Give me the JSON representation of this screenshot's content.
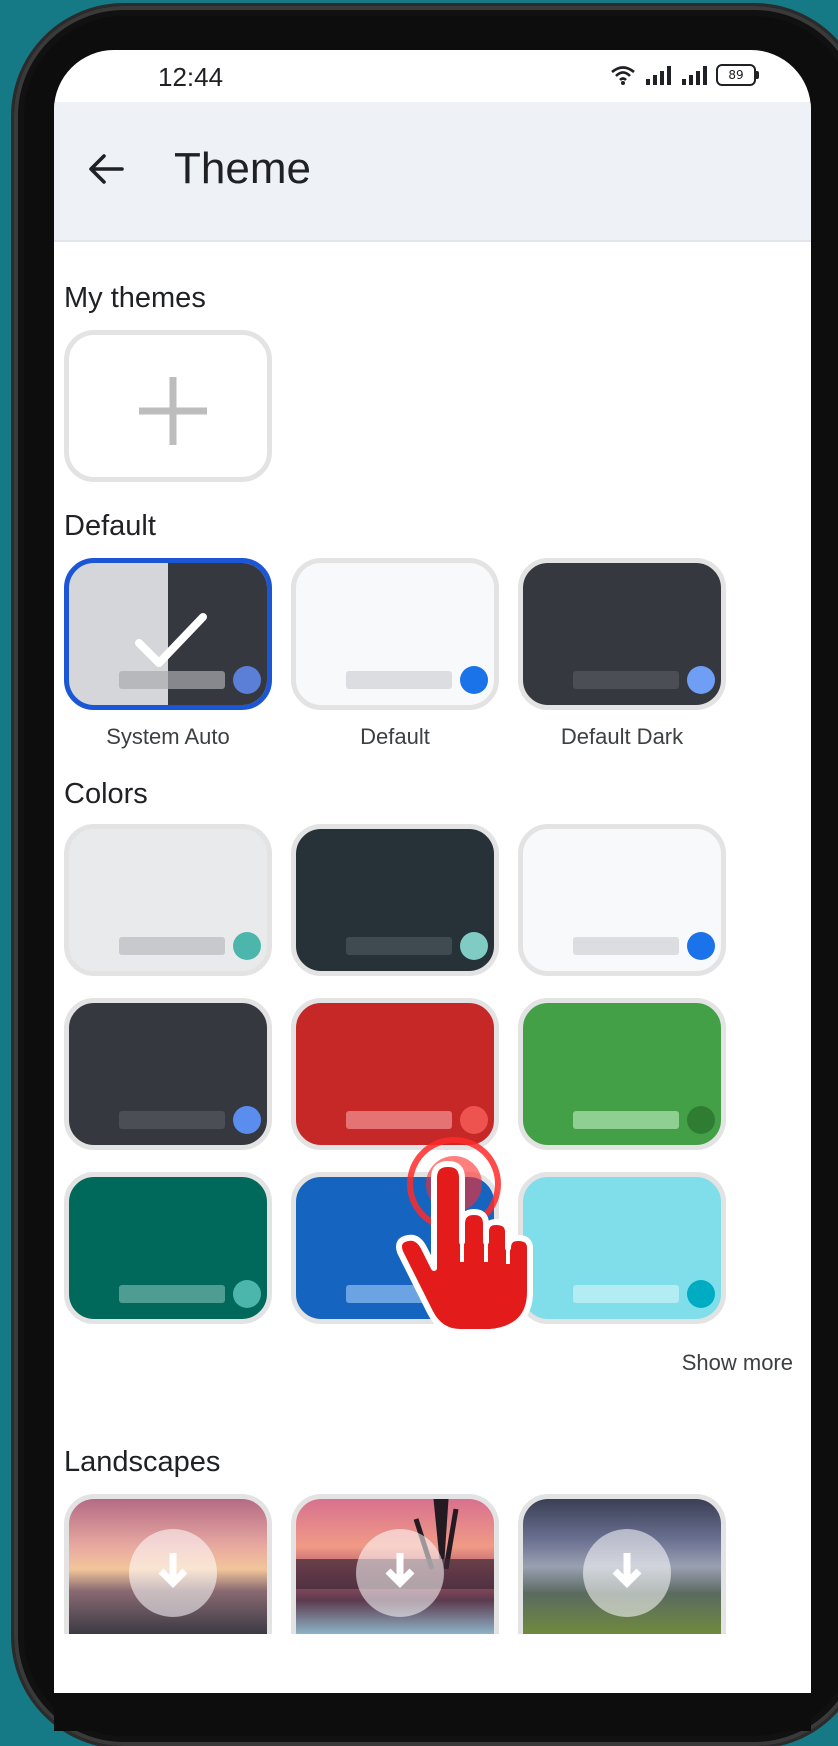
{
  "status_bar": {
    "time": "12:44",
    "battery": "89"
  },
  "app_bar": {
    "title": "Theme",
    "back_icon": "arrow-back-icon"
  },
  "sections": {
    "my_themes": "My themes",
    "default": "Default",
    "colors": "Colors",
    "landscapes": "Landscapes"
  },
  "default_themes": [
    {
      "label": "System Auto",
      "selected": true
    },
    {
      "label": "Default",
      "selected": false
    },
    {
      "label": "Default Dark",
      "selected": false
    }
  ],
  "color_themes": [
    {
      "bg": "#e9eaec",
      "bar": "#c7c9cc",
      "dot": "#4db6ac"
    },
    {
      "bg": "#263238",
      "bar": "#3f4b51",
      "dot": "#80cbc4"
    },
    {
      "bg": "#f8f9fa",
      "bar": "#dcdde0",
      "dot": "#1a73e8"
    },
    {
      "bg": "#35383e",
      "bar": "#4b4e55",
      "dot": "#5b8def"
    },
    {
      "bg": "#c62828",
      "bar": "#e57373",
      "dot": "#ef5350"
    },
    {
      "bg": "#43a047",
      "bar": "#8fcf92",
      "dot": "#2e7d32"
    },
    {
      "bg": "#00695c",
      "bar": "#4f9d92",
      "dot": "#4db6ac"
    },
    {
      "bg": "#1565c0",
      "bar": "#6ba3e3",
      "dot": "#2196f3"
    },
    {
      "bg": "#80deea",
      "bar": "#b4ecf3",
      "dot": "#00acc1"
    }
  ],
  "show_more": "Show more",
  "accent_color": "#1a56d6"
}
